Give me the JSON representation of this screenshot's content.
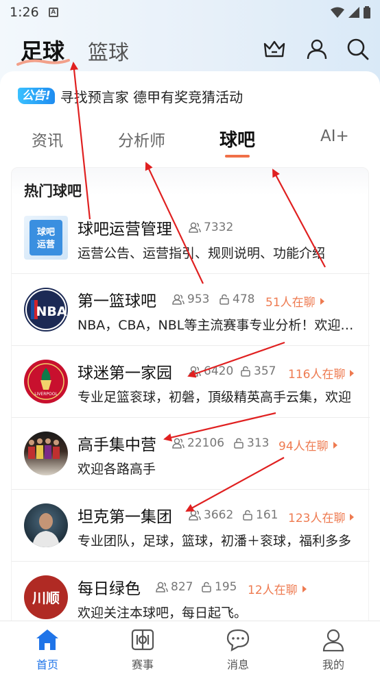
{
  "status_bar": {
    "time": "1:26",
    "sim_letter": "A"
  },
  "header": {
    "sport_tabs": [
      {
        "label": "足球",
        "active": true
      },
      {
        "label": "篮球",
        "active": false
      }
    ],
    "icons": [
      "crown-icon",
      "user-icon",
      "search-icon"
    ]
  },
  "notice": {
    "badge": "公告!",
    "text": "寻找预言家 德甲有奖竞猜活动"
  },
  "tabs": [
    {
      "label": "资讯",
      "active": false
    },
    {
      "label": "分析师",
      "active": false
    },
    {
      "label": "球吧",
      "active": true
    },
    {
      "label": "AI+",
      "active": false
    }
  ],
  "section": {
    "title": "热门球吧",
    "rows": [
      {
        "name": "球吧运营管理",
        "members": "7332",
        "posts": "",
        "chatting": "",
        "desc": "运营公告、运营指引、规则说明、功能介绍",
        "avatar_text": "球吧运营"
      },
      {
        "name": "第一篮球吧",
        "members": "953",
        "posts": "478",
        "chatting": "51人在聊",
        "desc": "NBA，CBA，NBL等主流赛事专业分析！欢迎加入",
        "avatar_text": "NBA"
      },
      {
        "name": "球迷第一家园",
        "members": "6420",
        "posts": "357",
        "chatting": "116人在聊",
        "desc": "专业足篮衮球，初磐，頂级精英高手云集，欢迎",
        "avatar_text": "LIVERPOOL"
      },
      {
        "name": "高手集中营",
        "members": "22106",
        "posts": "313",
        "chatting": "94人在聊",
        "desc": "欢迎各路高手",
        "avatar_text": ""
      },
      {
        "name": "坦克第一集团",
        "members": "3662",
        "posts": "161",
        "chatting": "123人在聊",
        "desc": "专业团队，足球，篮球，初潘＋衮球，福利多多",
        "avatar_text": ""
      },
      {
        "name": "每日绿色",
        "members": "827",
        "posts": "195",
        "chatting": "12人在聊",
        "desc": "欢迎关注本球吧，每日起飞。",
        "avatar_text": "川顺"
      }
    ]
  },
  "bottom_nav": [
    {
      "label": "首页",
      "icon": "home-icon",
      "active": true
    },
    {
      "label": "赛事",
      "icon": "match-icon",
      "active": false
    },
    {
      "label": "消息",
      "icon": "message-icon",
      "active": false
    },
    {
      "label": "我的",
      "icon": "profile-icon",
      "active": false
    }
  ],
  "colors": {
    "accent": "#ee7a50",
    "nav_active": "#1f74e8",
    "annotation": "#e02020"
  }
}
